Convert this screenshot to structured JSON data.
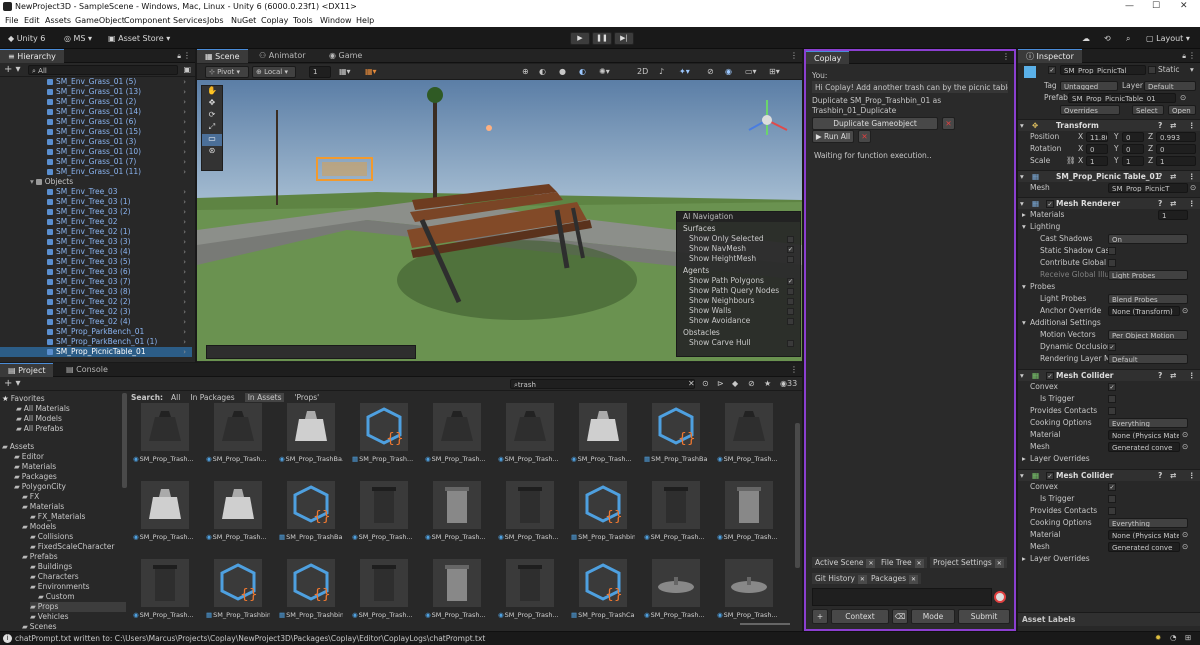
{
  "window": {
    "title": "NewProject3D - SampleScene - Windows, Mac, Linux - Unity 6 (6000.0.23f1) <DX11>"
  },
  "menu": [
    "File",
    "Edit",
    "Assets",
    "GameObject",
    "Component",
    "Services",
    "Jobs",
    "NuGet",
    "Coplay",
    "Tools",
    "Window",
    "Help"
  ],
  "toolbar": {
    "unity_label": "Unity 6",
    "account": "MS",
    "asset_store": "Asset Store",
    "layout": "Layout"
  },
  "hierarchy": {
    "tab": "Hierarchy",
    "search_placeholder": "All",
    "rows": [
      {
        "label": "SM_Env_Grass_01 (5)",
        "kind": "prefab"
      },
      {
        "label": "SM_Env_Grass_01 (13)",
        "kind": "prefab"
      },
      {
        "label": "SM_Env_Grass_01 (2)",
        "kind": "prefab"
      },
      {
        "label": "SM_Env_Grass_01 (14)",
        "kind": "prefab"
      },
      {
        "label": "SM_Env_Grass_01 (6)",
        "kind": "prefab"
      },
      {
        "label": "SM_Env_Grass_01 (15)",
        "kind": "prefab"
      },
      {
        "label": "SM_Env_Grass_01 (3)",
        "kind": "prefab"
      },
      {
        "label": "SM_Env_Grass_01 (10)",
        "kind": "prefab"
      },
      {
        "label": "SM_Env_Grass_01 (7)",
        "kind": "prefab"
      },
      {
        "label": "SM_Env_Grass_01 (11)",
        "kind": "prefab"
      },
      {
        "label": "Objects",
        "kind": "group"
      },
      {
        "label": "SM_Env_Tree_03",
        "kind": "prefab"
      },
      {
        "label": "SM_Env_Tree_03 (1)",
        "kind": "prefab"
      },
      {
        "label": "SM_Env_Tree_03 (2)",
        "kind": "prefab"
      },
      {
        "label": "SM_Env_Tree_02",
        "kind": "prefab"
      },
      {
        "label": "SM_Env_Tree_02 (1)",
        "kind": "prefab"
      },
      {
        "label": "SM_Env_Tree_03 (3)",
        "kind": "prefab"
      },
      {
        "label": "SM_Env_Tree_03 (4)",
        "kind": "prefab"
      },
      {
        "label": "SM_Env_Tree_03 (5)",
        "kind": "prefab"
      },
      {
        "label": "SM_Env_Tree_03 (6)",
        "kind": "prefab"
      },
      {
        "label": "SM_Env_Tree_03 (7)",
        "kind": "prefab"
      },
      {
        "label": "SM_Env_Tree_03 (8)",
        "kind": "prefab"
      },
      {
        "label": "SM_Env_Tree_02 (2)",
        "kind": "prefab"
      },
      {
        "label": "SM_Env_Tree_02 (3)",
        "kind": "prefab"
      },
      {
        "label": "SM_Env_Tree_02 (4)",
        "kind": "prefab"
      },
      {
        "label": "SM_Prop_ParkBench_01",
        "kind": "prefab"
      },
      {
        "label": "SM_Prop_ParkBench_01 (1)",
        "kind": "prefab"
      },
      {
        "label": "SM_Prop_PicnicTable_01",
        "kind": "selected"
      }
    ]
  },
  "scene": {
    "tabs": [
      "Scene",
      "Animator",
      "Game"
    ],
    "pivot": "Pivot",
    "local": "Local",
    "grid_value": "1",
    "mode_2d": "2D",
    "ai_nav": {
      "title": "AI Navigation",
      "sections": [
        {
          "header": "Surfaces",
          "items": [
            {
              "label": "Show Only Selected",
              "checked": false
            },
            {
              "label": "Show NavMesh",
              "checked": true
            },
            {
              "label": "Show HeightMesh",
              "checked": false
            }
          ]
        },
        {
          "header": "Agents",
          "items": [
            {
              "label": "Show Path Polygons",
              "checked": true
            },
            {
              "label": "Show Path Query Nodes",
              "checked": false
            },
            {
              "label": "Show Neighbours",
              "checked": false
            },
            {
              "label": "Show Walls",
              "checked": false
            },
            {
              "label": "Show Avoidance",
              "checked": false
            }
          ]
        },
        {
          "header": "Obstacles",
          "items": [
            {
              "label": "Show Carve Hull",
              "checked": false
            }
          ]
        }
      ]
    }
  },
  "project": {
    "tabs": [
      "Project",
      "Console"
    ],
    "search_value": "trash",
    "count": "33",
    "search_label": "Search:",
    "filters": [
      "All",
      "In Packages",
      "In Assets",
      "'Props'"
    ],
    "favorites_header": "Favorites",
    "favorites": [
      "All Materials",
      "All Models",
      "All Prefabs"
    ],
    "assets_header": "Assets",
    "tree": [
      {
        "label": "Editor",
        "d": 1
      },
      {
        "label": "Materials",
        "d": 1
      },
      {
        "label": "Packages",
        "d": 1
      },
      {
        "label": "PolygonCity",
        "d": 1
      },
      {
        "label": "FX",
        "d": 2
      },
      {
        "label": "Materials",
        "d": 2
      },
      {
        "label": "FX_Materials",
        "d": 3
      },
      {
        "label": "Models",
        "d": 2
      },
      {
        "label": "Collisions",
        "d": 3
      },
      {
        "label": "FixedScaleCharacter",
        "d": 3
      },
      {
        "label": "Prefabs",
        "d": 2
      },
      {
        "label": "Buildings",
        "d": 3
      },
      {
        "label": "Characters",
        "d": 3
      },
      {
        "label": "Environments",
        "d": 3
      },
      {
        "label": "Custom",
        "d": 4
      },
      {
        "label": "Props",
        "d": 3,
        "sel": true
      },
      {
        "label": "Vehicles",
        "d": 3
      },
      {
        "label": "Scenes",
        "d": 2
      }
    ],
    "assets": [
      {
        "label": "SM_Prop_Trash...",
        "kind": "bag_dark"
      },
      {
        "label": "SM_Prop_Trash...",
        "kind": "bag_dark"
      },
      {
        "label": "SM_Prop_TrashBa...",
        "kind": "bag_light"
      },
      {
        "label": "SM_Prop_Trash...",
        "kind": "script"
      },
      {
        "label": "SM_Prop_Trash...",
        "kind": "bag_dark"
      },
      {
        "label": "SM_Prop_Trash...",
        "kind": "bag_dark"
      },
      {
        "label": "SM_Prop_Trash...",
        "kind": "bag_light"
      },
      {
        "label": "SM_Prop_TrashBa...",
        "kind": "script"
      },
      {
        "label": "SM_Prop_Trash...",
        "kind": "bag_dark"
      },
      {
        "label": "SM_Prop_Trash...",
        "kind": "bag_light"
      },
      {
        "label": "SM_Prop_Trash...",
        "kind": "bag_light"
      },
      {
        "label": "SM_Prop_TrashBa...",
        "kind": "script"
      },
      {
        "label": "SM_Prop_Trash...",
        "kind": "bin"
      },
      {
        "label": "SM_Prop_Trash...",
        "kind": "bin_light"
      },
      {
        "label": "SM_Prop_Trash...",
        "kind": "bin"
      },
      {
        "label": "SM_Prop_Trashbin...",
        "kind": "script"
      },
      {
        "label": "SM_Prop_Trash...",
        "kind": "bin"
      },
      {
        "label": "SM_Prop_Trash...",
        "kind": "bin_light"
      },
      {
        "label": "SM_Prop_Trash...",
        "kind": "bin"
      },
      {
        "label": "SM_Prop_Trashbin...",
        "kind": "script"
      },
      {
        "label": "SM_Prop_Trashbin...",
        "kind": "script"
      },
      {
        "label": "SM_Prop_Trash...",
        "kind": "bin"
      },
      {
        "label": "SM_Prop_Trash...",
        "kind": "bin_light"
      },
      {
        "label": "SM_Prop_Trash...",
        "kind": "bin"
      },
      {
        "label": "SM_Prop_TrashCa...",
        "kind": "script"
      },
      {
        "label": "SM_Prop_Trash...",
        "kind": "lid"
      },
      {
        "label": "SM_Prop_Trash...",
        "kind": "lid"
      }
    ]
  },
  "coplay": {
    "tab": "Coplay",
    "you_label": "You:",
    "user_message": "Hi Coplay! Add another trash can by the picnic table",
    "assistant_text": "Duplicate SM_Prop_Trashbin_01 as Trashbin_01_Duplicate",
    "action_button": "Duplicate Gameobject",
    "run_all": "Run All",
    "status": "Waiting for function execution..",
    "context_tags": [
      "Active Scene",
      "File Tree",
      "Project Settings",
      "Git History",
      "Packages"
    ],
    "bottom": {
      "context": "Context",
      "mode": "Mode",
      "submit": "Submit",
      "plus": "+"
    }
  },
  "inspector": {
    "tab": "Inspector",
    "object_name": "SM_Prop_PicnicTal",
    "static_label": "Static",
    "tag_label": "Tag",
    "tag_value": "Untagged",
    "layer_label": "Layer",
    "layer_value": "Default",
    "prefab_label": "Prefab",
    "prefab_value": "SM_Prop_PicnicTable_01",
    "overrides": "Overrides",
    "select": "Select",
    "open": "Open",
    "transform": {
      "title": "Transform",
      "position": {
        "label": "Position",
        "x": "11.80€",
        "y": "0",
        "z": "0.993"
      },
      "rotation": {
        "label": "Rotation",
        "x": "0",
        "y": "0",
        "z": "0"
      },
      "scale": {
        "label": "Scale",
        "x": "1",
        "y": "1",
        "z": "1"
      }
    },
    "mesh_filter": {
      "title": "SM_Prop_Picnic Table_01",
      "mesh_label": "Mesh",
      "mesh_value": "SM_Prop_PicnicT"
    },
    "mesh_renderer": {
      "title": "Mesh Renderer",
      "materials_label": "Materials",
      "materials_count": "1",
      "lighting": "Lighting",
      "cast_shadows": "Cast Shadows",
      "cast_shadows_value": "On",
      "static_shadow": "Static Shadow Cas",
      "contribute_gi": "Contribute Global",
      "receive_gi": "Receive Global Illu",
      "receive_gi_value": "Light Probes",
      "probes": "Probes",
      "light_probes": "Light Probes",
      "light_probes_value": "Blend Probes",
      "anchor_override": "Anchor Override",
      "anchor_override_value": "None (Transform)",
      "additional": "Additional Settings",
      "motion_vectors": "Motion Vectors",
      "motion_vectors_value": "Per Object Motion",
      "dynamic_occlusion": "Dynamic Occlusion",
      "rendering_layer": "Rendering Layer M",
      "rendering_layer_value": "Default"
    },
    "colliders": [
      {
        "title": "Mesh Collider",
        "convex": "Convex",
        "is_trigger": "Is Trigger",
        "provides_contacts": "Provides Contacts",
        "cooking": "Cooking Options",
        "cooking_value": "Everything",
        "material": "Material",
        "material_value": "None (Physics Mate",
        "mesh": "Mesh",
        "mesh_value": "Generated conve",
        "layer_overrides": "Layer Overrides"
      },
      {
        "title": "Mesh Collider",
        "convex": "Convex",
        "is_trigger": "Is Trigger",
        "provides_contacts": "Provides Contacts",
        "cooking": "Cooking Options",
        "cooking_value": "Everything",
        "material": "Material",
        "material_value": "None (Physics Mate",
        "mesh": "Mesh",
        "mesh_value": "Generated conve",
        "layer_overrides": "Layer Overrides"
      }
    ],
    "asset_labels": "Asset Labels"
  },
  "status_bar": {
    "message": "chatPrompt.txt written to: C:\\Users\\Marcus\\Projects\\Coplay\\NewProject3D\\Packages\\Coplay\\Editor\\CoplayLogs\\chatPrompt.txt"
  },
  "colors": {
    "accent": "#8b3fd0",
    "selection": "#2c5d87",
    "prefab_text": "#8ab4f0",
    "script_icon": "#4ea0e0"
  }
}
